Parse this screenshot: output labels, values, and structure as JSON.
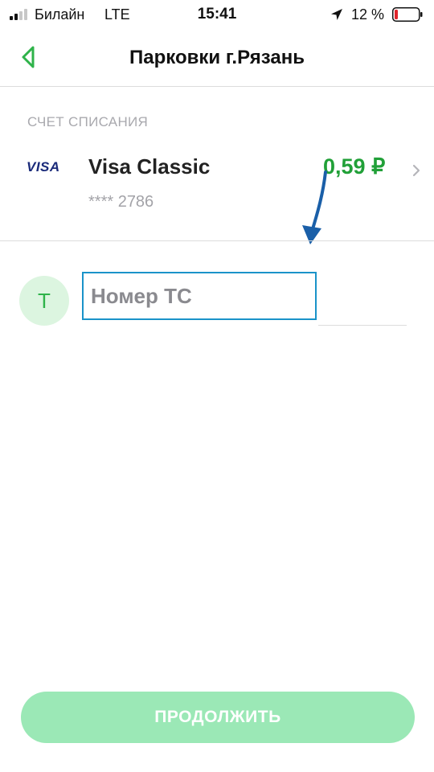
{
  "status_bar": {
    "carrier": "Билайн",
    "network": "LTE",
    "time": "15:41",
    "battery_percent": "12 %",
    "signal_bars_active": 2,
    "signal_bars_total": 4,
    "battery_level": 0.12
  },
  "header": {
    "title": "Парковки г.Рязань",
    "back_icon": "chevron-left-icon"
  },
  "account": {
    "section_label": "СЧЕТ СПИСАНИЯ",
    "card_brand": "VISA",
    "card_name": "Visa Classic",
    "card_number": "**** 2786",
    "balance": ",59 ₽",
    "balance_leading": "0"
  },
  "vehicle": {
    "avatar_letter": "Т",
    "plate_placeholder": "Номер ТС",
    "plate_value": ""
  },
  "actions": {
    "continue_label": "ПРОДОЛЖИТЬ"
  },
  "colors": {
    "accent": "#21a038",
    "button_disabled": "#9be8b6",
    "input_focus": "#1a93c9"
  }
}
